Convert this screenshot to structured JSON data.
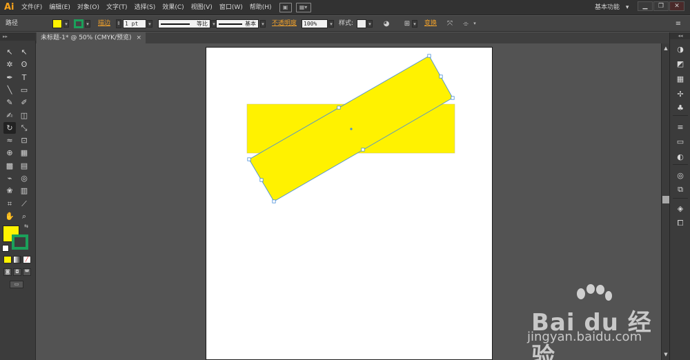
{
  "app": {
    "logo": "Ai"
  },
  "menus": [
    "文件(F)",
    "编辑(E)",
    "对象(O)",
    "文字(T)",
    "选择(S)",
    "效果(C)",
    "视图(V)",
    "窗口(W)",
    "帮助(H)"
  ],
  "workspace": {
    "label": "基本功能",
    "caret": "▾"
  },
  "window_controls": {
    "minimize": "▁",
    "restore": "❐",
    "close": "✕"
  },
  "controlbar": {
    "selection_label": "路径",
    "fill_color": "#fff200",
    "stroke_color": "#1ba05a",
    "stroke_link": "描边",
    "stroke_weight": "1 pt",
    "variable_width_label": "等比",
    "brush_label": "基本",
    "opacity_link": "不透明度",
    "opacity_value": "100%",
    "style_label": "样式:",
    "transform_link": "变换"
  },
  "document": {
    "tab_title": "未标题-1* @ 50% (CMYK/预览)",
    "close": "×"
  },
  "tools": [
    {
      "icon": "selection-tool-icon",
      "glyph": "↖"
    },
    {
      "icon": "direct-selection-tool-icon",
      "glyph": "↖"
    },
    {
      "icon": "magic-wand-tool-icon",
      "glyph": "✲"
    },
    {
      "icon": "lasso-tool-icon",
      "glyph": "ʘ"
    },
    {
      "icon": "pen-tool-icon",
      "glyph": "✒"
    },
    {
      "icon": "type-tool-icon",
      "glyph": "T"
    },
    {
      "icon": "line-tool-icon",
      "glyph": "╲"
    },
    {
      "icon": "rectangle-tool-icon",
      "glyph": "▭"
    },
    {
      "icon": "paintbrush-tool-icon",
      "glyph": "✎"
    },
    {
      "icon": "pencil-tool-icon",
      "glyph": "✐"
    },
    {
      "icon": "blob-brush-tool-icon",
      "glyph": "✍"
    },
    {
      "icon": "eraser-tool-icon",
      "glyph": "◫"
    },
    {
      "icon": "rotate-tool-icon",
      "glyph": "↻"
    },
    {
      "icon": "scale-tool-icon",
      "glyph": "⤡"
    },
    {
      "icon": "warp-tool-icon",
      "glyph": "≈"
    },
    {
      "icon": "free-transform-tool-icon",
      "glyph": "⊡"
    },
    {
      "icon": "shape-builder-tool-icon",
      "glyph": "⊕"
    },
    {
      "icon": "perspective-grid-tool-icon",
      "glyph": "▦"
    },
    {
      "icon": "mesh-tool-icon",
      "glyph": "▩"
    },
    {
      "icon": "gradient-tool-icon",
      "glyph": "▤"
    },
    {
      "icon": "eyedropper-tool-icon",
      "glyph": "⌁"
    },
    {
      "icon": "blend-tool-icon",
      "glyph": "◎"
    },
    {
      "icon": "symbol-sprayer-tool-icon",
      "glyph": "❀"
    },
    {
      "icon": "column-graph-tool-icon",
      "glyph": "▥"
    },
    {
      "icon": "artboard-tool-icon",
      "glyph": "⌗"
    },
    {
      "icon": "slice-tool-icon",
      "glyph": "⟋"
    },
    {
      "icon": "hand-tool-icon",
      "glyph": "✋"
    },
    {
      "icon": "zoom-tool-icon",
      "glyph": "⌕"
    }
  ],
  "panels": [
    {
      "icon": "color-panel-icon",
      "glyph": "◑"
    },
    {
      "icon": "color-guide-panel-icon",
      "glyph": "◩"
    },
    {
      "icon": "swatches-panel-icon",
      "glyph": "▦"
    },
    {
      "icon": "brushes-panel-icon",
      "glyph": "✢"
    },
    {
      "icon": "symbols-panel-icon",
      "glyph": "♣"
    },
    {
      "icon": "stroke-panel-icon",
      "glyph": "≡"
    },
    {
      "icon": "gradient-panel-icon",
      "glyph": "▭"
    },
    {
      "icon": "transparency-panel-icon",
      "glyph": "◐"
    },
    {
      "icon": "appearance-panel-icon",
      "glyph": "◎"
    },
    {
      "icon": "graphic-styles-panel-icon",
      "glyph": "⧉"
    },
    {
      "icon": "layers-panel-icon",
      "glyph": "◈"
    },
    {
      "icon": "artboards-panel-icon",
      "glyph": "⧠"
    }
  ],
  "artwork": {
    "shape_fill": "#fff200",
    "selection_color": "#4a8fd8",
    "anchor_fill": "#ffffff"
  },
  "watermark": {
    "brand": "Bai du 经验",
    "url": "jingyan.baidu.com"
  }
}
